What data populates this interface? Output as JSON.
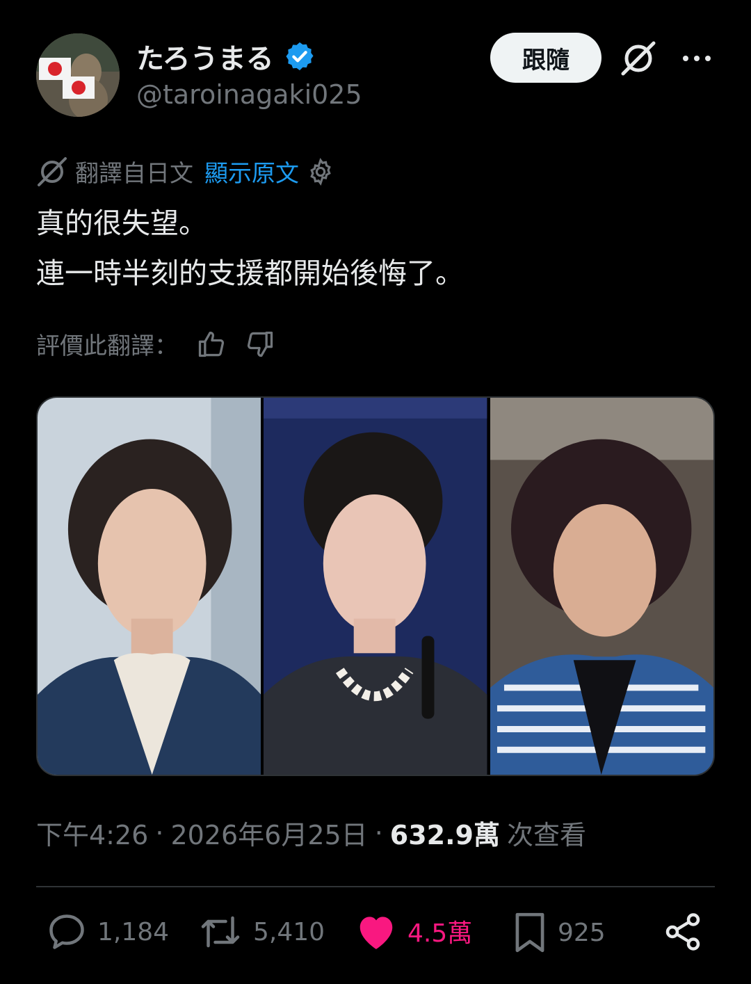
{
  "header": {
    "display_name": "たろうまる",
    "handle": "@taroinagaki025",
    "follow_label": "跟隨",
    "verified_color": "#1d9bf0"
  },
  "translation": {
    "label": "翻譯自日文",
    "show_original": "顯示原文"
  },
  "tweet": {
    "lines": [
      "真的很失望。",
      "連一時半刻的支援都開始後悔了。"
    ]
  },
  "rate": {
    "label": "評價此翻譯："
  },
  "meta": {
    "time": "下午4:26",
    "date": "2026年6月25日",
    "views": "632.9萬",
    "views_label": "次查看",
    "sep": "·"
  },
  "actions": {
    "replies": "1,184",
    "reposts": "5,410",
    "likes": "4.5萬",
    "bookmarks": "925"
  },
  "colors": {
    "like": "#f91880",
    "link": "#1d9bf0",
    "muted": "#71767b"
  }
}
